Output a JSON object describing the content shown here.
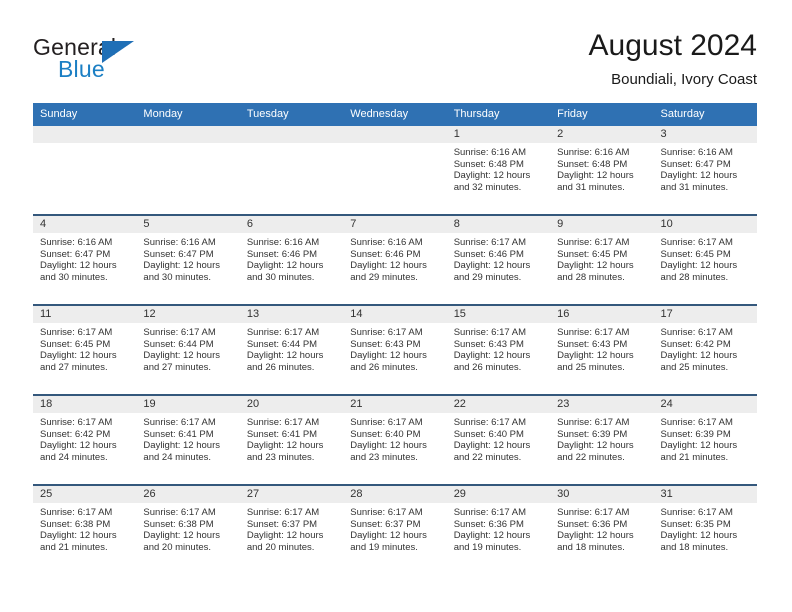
{
  "brand": {
    "name_part1": "General",
    "name_part2": "Blue",
    "logo_icon": "triangle-flag-icon",
    "blue": "#1f6fb6"
  },
  "header": {
    "month_title": "August 2024",
    "location": "Boundiali, Ivory Coast"
  },
  "theme": {
    "header_blue": "#2f71b3",
    "row_divider": "#34587c",
    "daynum_band": "#ededed",
    "text": "#333333"
  },
  "calendar": {
    "weekday_headers": [
      "Sunday",
      "Monday",
      "Tuesday",
      "Wednesday",
      "Thursday",
      "Friday",
      "Saturday"
    ],
    "weeks": [
      [
        {
          "day": "",
          "lines": []
        },
        {
          "day": "",
          "lines": []
        },
        {
          "day": "",
          "lines": []
        },
        {
          "day": "",
          "lines": []
        },
        {
          "day": "1",
          "lines": [
            "Sunrise: 6:16 AM",
            "Sunset: 6:48 PM",
            "Daylight: 12 hours",
            "and 32 minutes."
          ]
        },
        {
          "day": "2",
          "lines": [
            "Sunrise: 6:16 AM",
            "Sunset: 6:48 PM",
            "Daylight: 12 hours",
            "and 31 minutes."
          ]
        },
        {
          "day": "3",
          "lines": [
            "Sunrise: 6:16 AM",
            "Sunset: 6:47 PM",
            "Daylight: 12 hours",
            "and 31 minutes."
          ]
        }
      ],
      [
        {
          "day": "4",
          "lines": [
            "Sunrise: 6:16 AM",
            "Sunset: 6:47 PM",
            "Daylight: 12 hours",
            "and 30 minutes."
          ]
        },
        {
          "day": "5",
          "lines": [
            "Sunrise: 6:16 AM",
            "Sunset: 6:47 PM",
            "Daylight: 12 hours",
            "and 30 minutes."
          ]
        },
        {
          "day": "6",
          "lines": [
            "Sunrise: 6:16 AM",
            "Sunset: 6:46 PM",
            "Daylight: 12 hours",
            "and 30 minutes."
          ]
        },
        {
          "day": "7",
          "lines": [
            "Sunrise: 6:16 AM",
            "Sunset: 6:46 PM",
            "Daylight: 12 hours",
            "and 29 minutes."
          ]
        },
        {
          "day": "8",
          "lines": [
            "Sunrise: 6:17 AM",
            "Sunset: 6:46 PM",
            "Daylight: 12 hours",
            "and 29 minutes."
          ]
        },
        {
          "day": "9",
          "lines": [
            "Sunrise: 6:17 AM",
            "Sunset: 6:45 PM",
            "Daylight: 12 hours",
            "and 28 minutes."
          ]
        },
        {
          "day": "10",
          "lines": [
            "Sunrise: 6:17 AM",
            "Sunset: 6:45 PM",
            "Daylight: 12 hours",
            "and 28 minutes."
          ]
        }
      ],
      [
        {
          "day": "11",
          "lines": [
            "Sunrise: 6:17 AM",
            "Sunset: 6:45 PM",
            "Daylight: 12 hours",
            "and 27 minutes."
          ]
        },
        {
          "day": "12",
          "lines": [
            "Sunrise: 6:17 AM",
            "Sunset: 6:44 PM",
            "Daylight: 12 hours",
            "and 27 minutes."
          ]
        },
        {
          "day": "13",
          "lines": [
            "Sunrise: 6:17 AM",
            "Sunset: 6:44 PM",
            "Daylight: 12 hours",
            "and 26 minutes."
          ]
        },
        {
          "day": "14",
          "lines": [
            "Sunrise: 6:17 AM",
            "Sunset: 6:43 PM",
            "Daylight: 12 hours",
            "and 26 minutes."
          ]
        },
        {
          "day": "15",
          "lines": [
            "Sunrise: 6:17 AM",
            "Sunset: 6:43 PM",
            "Daylight: 12 hours",
            "and 26 minutes."
          ]
        },
        {
          "day": "16",
          "lines": [
            "Sunrise: 6:17 AM",
            "Sunset: 6:43 PM",
            "Daylight: 12 hours",
            "and 25 minutes."
          ]
        },
        {
          "day": "17",
          "lines": [
            "Sunrise: 6:17 AM",
            "Sunset: 6:42 PM",
            "Daylight: 12 hours",
            "and 25 minutes."
          ]
        }
      ],
      [
        {
          "day": "18",
          "lines": [
            "Sunrise: 6:17 AM",
            "Sunset: 6:42 PM",
            "Daylight: 12 hours",
            "and 24 minutes."
          ]
        },
        {
          "day": "19",
          "lines": [
            "Sunrise: 6:17 AM",
            "Sunset: 6:41 PM",
            "Daylight: 12 hours",
            "and 24 minutes."
          ]
        },
        {
          "day": "20",
          "lines": [
            "Sunrise: 6:17 AM",
            "Sunset: 6:41 PM",
            "Daylight: 12 hours",
            "and 23 minutes."
          ]
        },
        {
          "day": "21",
          "lines": [
            "Sunrise: 6:17 AM",
            "Sunset: 6:40 PM",
            "Daylight: 12 hours",
            "and 23 minutes."
          ]
        },
        {
          "day": "22",
          "lines": [
            "Sunrise: 6:17 AM",
            "Sunset: 6:40 PM",
            "Daylight: 12 hours",
            "and 22 minutes."
          ]
        },
        {
          "day": "23",
          "lines": [
            "Sunrise: 6:17 AM",
            "Sunset: 6:39 PM",
            "Daylight: 12 hours",
            "and 22 minutes."
          ]
        },
        {
          "day": "24",
          "lines": [
            "Sunrise: 6:17 AM",
            "Sunset: 6:39 PM",
            "Daylight: 12 hours",
            "and 21 minutes."
          ]
        }
      ],
      [
        {
          "day": "25",
          "lines": [
            "Sunrise: 6:17 AM",
            "Sunset: 6:38 PM",
            "Daylight: 12 hours",
            "and 21 minutes."
          ]
        },
        {
          "day": "26",
          "lines": [
            "Sunrise: 6:17 AM",
            "Sunset: 6:38 PM",
            "Daylight: 12 hours",
            "and 20 minutes."
          ]
        },
        {
          "day": "27",
          "lines": [
            "Sunrise: 6:17 AM",
            "Sunset: 6:37 PM",
            "Daylight: 12 hours",
            "and 20 minutes."
          ]
        },
        {
          "day": "28",
          "lines": [
            "Sunrise: 6:17 AM",
            "Sunset: 6:37 PM",
            "Daylight: 12 hours",
            "and 19 minutes."
          ]
        },
        {
          "day": "29",
          "lines": [
            "Sunrise: 6:17 AM",
            "Sunset: 6:36 PM",
            "Daylight: 12 hours",
            "and 19 minutes."
          ]
        },
        {
          "day": "30",
          "lines": [
            "Sunrise: 6:17 AM",
            "Sunset: 6:36 PM",
            "Daylight: 12 hours",
            "and 18 minutes."
          ]
        },
        {
          "day": "31",
          "lines": [
            "Sunrise: 6:17 AM",
            "Sunset: 6:35 PM",
            "Daylight: 12 hours",
            "and 18 minutes."
          ]
        }
      ]
    ]
  }
}
